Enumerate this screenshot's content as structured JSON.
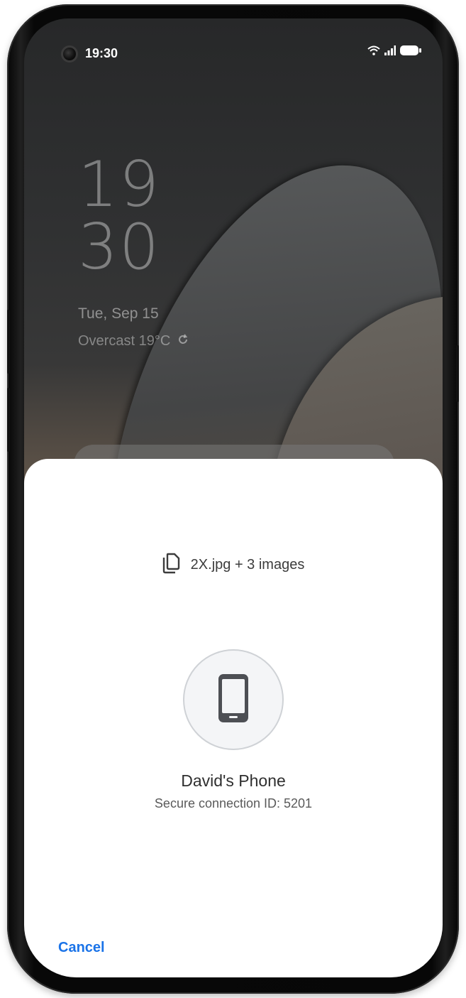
{
  "status_bar": {
    "time": "19:30"
  },
  "lock_screen": {
    "hour": "19",
    "minute": "30",
    "date": "Tue, Sep 15",
    "weather": "Overcast 19°C"
  },
  "share_sheet": {
    "files_label": "2X.jpg + 3 images",
    "target_device": {
      "name": "David's Phone",
      "connection": "Secure connection ID: 5201"
    },
    "cancel_label": "Cancel"
  },
  "colors": {
    "accent": "#1a73e8",
    "sheet_background": "#ffffff",
    "device_circle_fill": "#f4f5f7"
  },
  "icons": [
    "camera-icon",
    "wifi-icon",
    "signal-icon",
    "battery-icon",
    "refresh-icon",
    "copy-files-icon",
    "smartphone-icon"
  ]
}
